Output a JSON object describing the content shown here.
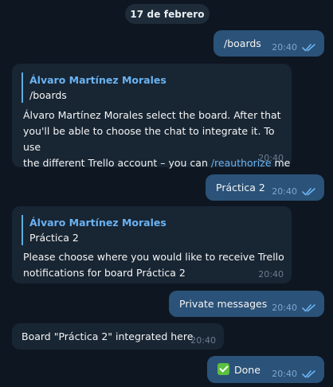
{
  "date_label": "17 de febrero",
  "colors": {
    "background": "#0e1621",
    "incoming_bubble": "#182533",
    "outgoing_bubble": "#2b5278",
    "link": "#6ab3f3",
    "read_ticks": "#6ab3f3"
  },
  "messages": [
    {
      "direction": "outgoing",
      "text": "/boards",
      "time": "20:40",
      "status": "read"
    },
    {
      "direction": "incoming",
      "reply": {
        "author": "Álvaro Martínez Morales",
        "text": "/boards"
      },
      "text_lines": [
        "Álvaro Martínez Morales select the board. After that",
        "you'll be able to choose the chat to integrate it. To use"
      ],
      "text_line3_prefix": "the different Trello account – you can ",
      "text_line3_link": "/reauthorize",
      "text_line3_suffix": " me",
      "time": "20:40"
    },
    {
      "direction": "outgoing",
      "text": "Práctica 2",
      "time": "20:40",
      "status": "read"
    },
    {
      "direction": "incoming",
      "reply": {
        "author": "Álvaro Martínez Morales",
        "text": "Práctica 2"
      },
      "text_lines": [
        "Please choose where you would like to receive Trello",
        "notifications for board Práctica 2"
      ],
      "time": "20:40"
    },
    {
      "direction": "outgoing",
      "text": "Private messages",
      "time": "20:40",
      "status": "read"
    },
    {
      "direction": "incoming",
      "text": "Board \"Práctica 2\" integrated here",
      "time": "20:40"
    },
    {
      "direction": "outgoing",
      "emoji": "check-mark-button-emoji",
      "text": "Done",
      "time": "20:40",
      "status": "read"
    }
  ]
}
